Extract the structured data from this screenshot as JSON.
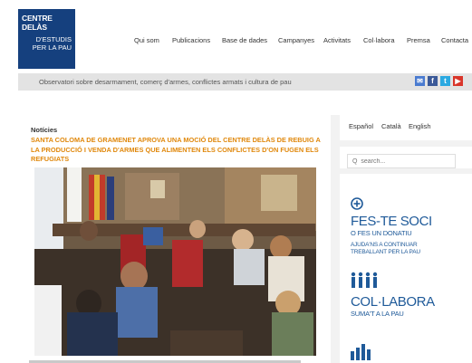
{
  "logo": {
    "line1": "CENTRE DELÀS",
    "line2": "D'ESTUDIS",
    "line3": "PER LA PAU"
  },
  "nav": [
    "Qui som",
    "Publicacions",
    "Base de dades",
    "Campanyes",
    "Activitats",
    "Col·labora",
    "Premsa",
    "Contacta"
  ],
  "tagline": "Observatori sobre desarmament, comerç d'armes, conflictes armats i cultura de pau",
  "social": [
    {
      "icon": "mail-icon",
      "label": "✉",
      "color": "#4a7bd0"
    },
    {
      "icon": "facebook-icon",
      "label": "f",
      "color": "#3b5998"
    },
    {
      "icon": "twitter-icon",
      "label": "t",
      "color": "#2ba9e1"
    },
    {
      "icon": "youtube-icon",
      "label": "▶",
      "color": "#d9362b"
    }
  ],
  "news": {
    "section": "Notícies",
    "headline": "SANTA COLOMA DE GRAMENET APROVA UNA MOCIÓ DEL CENTRE DELÀS DE REBUIG A LA PRODUCCIÓ I VENDA D'ARMES QUE ALIMENTEN ELS CONFLICTES D'ON FUGEN ELS REFUGIATS"
  },
  "languages": [
    "Español",
    "Català",
    "English"
  ],
  "search": {
    "placeholder": "Q  search..."
  },
  "promo": {
    "join_title": "FES-TE SOCI",
    "join_sub": "O FES UN DONATIU",
    "join_small1": "AJUDA'NS A CONTINUAR",
    "join_small2": "TREBALLANT PER LA PAU",
    "collab_title": "COL·LABORA",
    "collab_sub": "SUMA'T A LA PAU"
  }
}
